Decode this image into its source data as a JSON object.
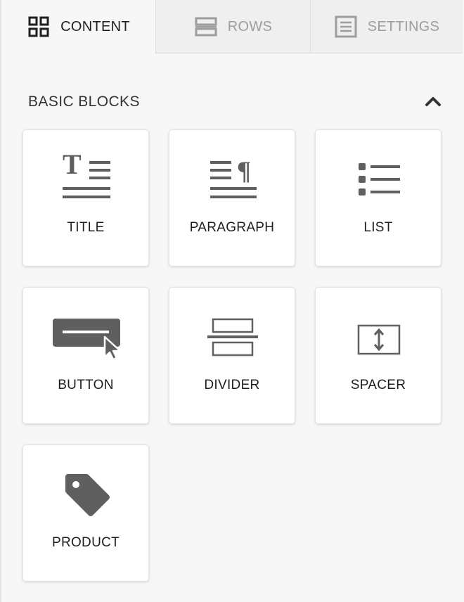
{
  "tabs": [
    {
      "label": "CONTENT",
      "icon": "content-grid-icon",
      "active": true
    },
    {
      "label": "ROWS",
      "icon": "rows-icon",
      "active": false
    },
    {
      "label": "SETTINGS",
      "icon": "settings-document-icon",
      "active": false
    }
  ],
  "section": {
    "title": "BASIC BLOCKS",
    "toggle_icon": "chevron-up-icon",
    "expanded": true
  },
  "blocks": [
    {
      "label": "TITLE",
      "icon": "title-icon"
    },
    {
      "label": "PARAGRAPH",
      "icon": "paragraph-icon"
    },
    {
      "label": "LIST",
      "icon": "list-icon"
    },
    {
      "label": "BUTTON",
      "icon": "button-icon"
    },
    {
      "label": "DIVIDER",
      "icon": "divider-icon"
    },
    {
      "label": "SPACER",
      "icon": "spacer-icon"
    },
    {
      "label": "PRODUCT",
      "icon": "product-tag-icon"
    }
  ],
  "colors": {
    "panel_background": "#f7f7f7",
    "tab_background": "#efefef",
    "active_text": "#202020",
    "inactive_text": "#9d9d9d",
    "icon": "#5f5f5f",
    "card_background": "#ffffff"
  }
}
